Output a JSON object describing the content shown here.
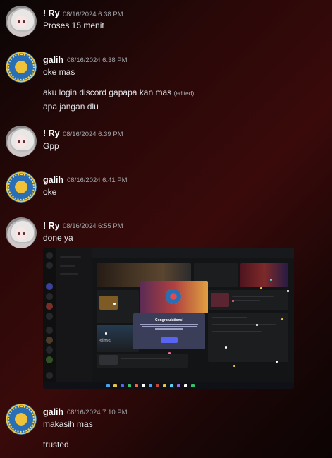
{
  "messages": [
    {
      "author": "! Ry",
      "timestamp": "08/16/2024 6:38 PM",
      "lines": [
        "Proses 15 menit"
      ]
    },
    {
      "author": "galih",
      "timestamp": "08/16/2024 6:38 PM",
      "lines": [
        "oke mas",
        "aku login discord gapapa kan mas",
        "apa jangan dlu"
      ],
      "edited_label": "(edited)"
    },
    {
      "author": "! Ry",
      "timestamp": "08/16/2024 6:39 PM",
      "lines": [
        "Gpp"
      ]
    },
    {
      "author": "galih",
      "timestamp": "08/16/2024 6:41 PM",
      "lines": [
        "oke"
      ]
    },
    {
      "author": "! Ry",
      "timestamp": "08/16/2024 6:55 PM",
      "lines": [
        "done ya"
      ]
    },
    {
      "author": "galih",
      "timestamp": "08/16/2024 7:10 PM",
      "lines": [
        "makasih mas",
        "trusted"
      ]
    }
  ],
  "attachment": {
    "modal_title": "Congratulations!",
    "game_label": "sims"
  },
  "colors": {
    "accent": "#5865f2",
    "text": "#e3e5e8",
    "muted": "#a3a6aa"
  }
}
